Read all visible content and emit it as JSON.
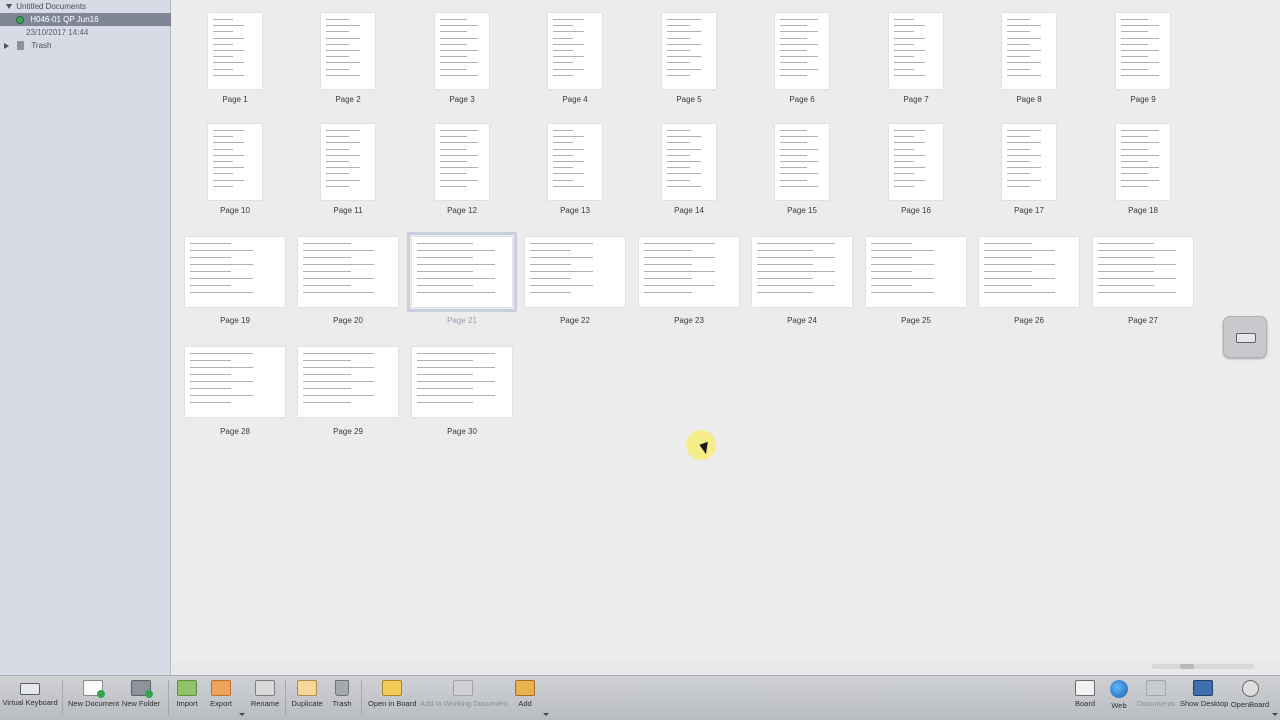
{
  "sidebar": {
    "root_label": "Untitled Documents",
    "selected_document": "H046-01 QP Jun16",
    "selected_date": "23/10/2017 14:44",
    "trash_label": "Trash"
  },
  "pages": [
    {
      "label": "Page 1"
    },
    {
      "label": "Page 2"
    },
    {
      "label": "Page 3"
    },
    {
      "label": "Page 4"
    },
    {
      "label": "Page 5"
    },
    {
      "label": "Page 6"
    },
    {
      "label": "Page 7"
    },
    {
      "label": "Page 8"
    },
    {
      "label": "Page 9"
    },
    {
      "label": "Page 10"
    },
    {
      "label": "Page 11"
    },
    {
      "label": "Page 12"
    },
    {
      "label": "Page 13"
    },
    {
      "label": "Page 14"
    },
    {
      "label": "Page 15"
    },
    {
      "label": "Page 16"
    },
    {
      "label": "Page 17"
    },
    {
      "label": "Page 18"
    },
    {
      "label": "Page 19"
    },
    {
      "label": "Page 20"
    },
    {
      "label": "Page 21"
    },
    {
      "label": "Page 22"
    },
    {
      "label": "Page 23"
    },
    {
      "label": "Page 24"
    },
    {
      "label": "Page 25"
    },
    {
      "label": "Page 26"
    },
    {
      "label": "Page 27"
    },
    {
      "label": "Page 28"
    },
    {
      "label": "Page 29"
    },
    {
      "label": "Page 30"
    }
  ],
  "selected_page": "Page 21",
  "toolbar": {
    "virtual_keyboard": "Virtual Keyboard",
    "new_document": "New Document",
    "new_folder": "New Folder",
    "import": "Import",
    "export": "Export",
    "rename": "Rename",
    "duplicate": "Duplicate",
    "trash": "Trash",
    "open_in_board": "Open in Board",
    "add_to_working_document": "Add to Working Document",
    "add": "Add",
    "board": "Board",
    "web": "Web",
    "documents": "Documents",
    "show_desktop": "Show Desktop",
    "openboard": "OpenBoard"
  },
  "icons": {
    "virtual_keyboard": "keyboard-icon",
    "new_document": "new-document-icon",
    "new_folder": "new-folder-icon",
    "import": "import-icon",
    "export": "export-icon",
    "rename": "rename-icon",
    "duplicate": "duplicate-icon",
    "trash": "trash-icon",
    "open_in_board": "open-in-board-icon",
    "add_to_working_document": "add-to-working-document-icon",
    "add": "add-icon",
    "board": "board-icon",
    "web": "globe-icon",
    "documents": "documents-icon",
    "show_desktop": "desktop-icon",
    "openboard": "gear-icon"
  },
  "colors": {
    "sidebar_bg": "#d6dbe6",
    "selection_bg": "#7f8797",
    "document_status_dot": "#3aa35b",
    "cursor_highlight": "#f7ec78"
  }
}
